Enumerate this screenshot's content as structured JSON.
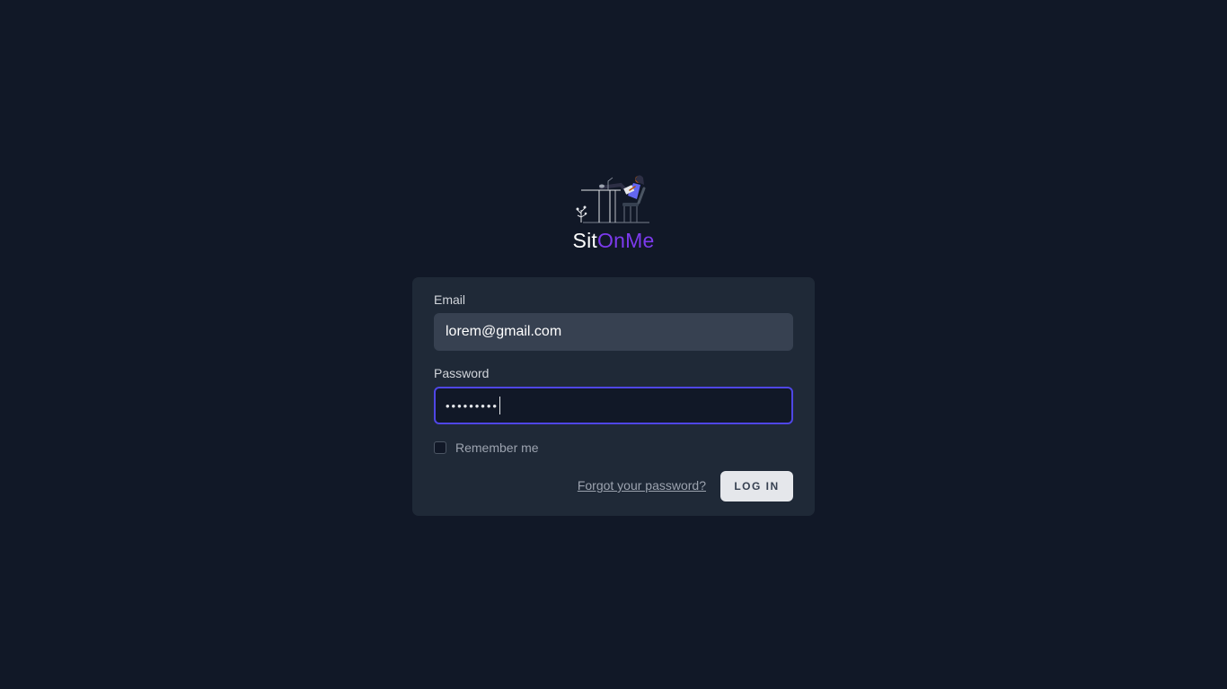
{
  "logo": {
    "name_part1": "Sit",
    "name_part2": "OnMe",
    "accent_color": "#7c3aed",
    "icon": "person-sitting-at-desk-illustration"
  },
  "form": {
    "email_label": "Email",
    "email_value": "lorem@gmail.com",
    "password_label": "Password",
    "password_masked": "•••••••••",
    "remember_label": "Remember me",
    "remember_checked": false,
    "forgot_link": "Forgot your password?",
    "login_button": "LOG IN"
  },
  "colors": {
    "background": "#111827",
    "card": "#1f2937",
    "focus_ring": "#4f46e5"
  }
}
